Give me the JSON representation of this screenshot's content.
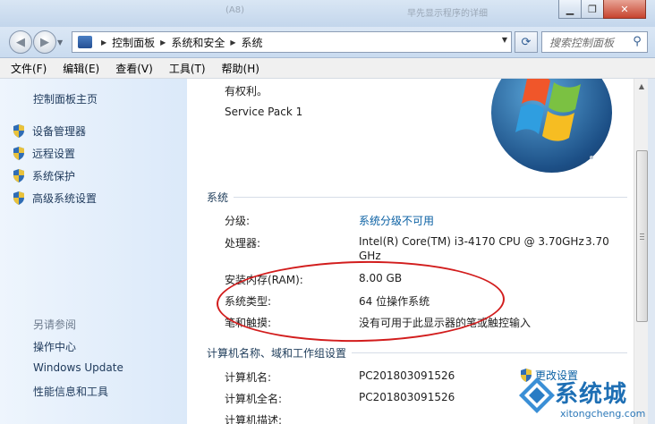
{
  "titlebar": {
    "ghost_left": "(A8)",
    "ghost_right": "早先显示程序的详细"
  },
  "address_bar": {
    "breadcrumbs": [
      "控制面板",
      "系统和安全",
      "系统"
    ],
    "search_placeholder": "搜索控制面板"
  },
  "menu": {
    "items": [
      "文件(F)",
      "编辑(E)",
      "查看(V)",
      "工具(T)",
      "帮助(H)"
    ]
  },
  "left_nav": {
    "home": "控制面板主页",
    "tasks": [
      "设备管理器",
      "远程设置",
      "系统保护",
      "高级系统设置"
    ],
    "see_also_title": "另请参阅",
    "see_also": [
      "操作中心",
      "Windows Update",
      "性能信息和工具"
    ]
  },
  "edition": {
    "rights_text": "有权利。",
    "service_pack": "Service Pack 1"
  },
  "system": {
    "title": "系统",
    "rows": [
      {
        "label": "分级:",
        "value": "系统分级不可用"
      },
      {
        "label": "处理器:",
        "value": "Intel(R) Core(TM) i3-4170 CPU @ 3.70GHz",
        "value_extra": "3.70",
        "value_line2": "GHz"
      },
      {
        "label": "安装内存(RAM):",
        "value": "8.00 GB"
      },
      {
        "label": "系统类型:",
        "value": "64 位操作系统"
      },
      {
        "label": "笔和触摸:",
        "value": "没有可用于此显示器的笔或触控输入"
      }
    ]
  },
  "computer": {
    "title": "计算机名称、域和工作组设置",
    "change_settings": "更改设置",
    "rows": [
      {
        "label": "计算机名:",
        "value": "PC201803091526"
      },
      {
        "label": "计算机全名:",
        "value": "PC201803091526"
      },
      {
        "label": "计算机描述:",
        "value": ""
      }
    ]
  },
  "watermark": {
    "text": "系统城",
    "url": "xitongcheng.com"
  },
  "colors": {
    "link": "#0b61a4",
    "annotation": "#d21d1d",
    "nav_bg": "#dbe9f9"
  }
}
